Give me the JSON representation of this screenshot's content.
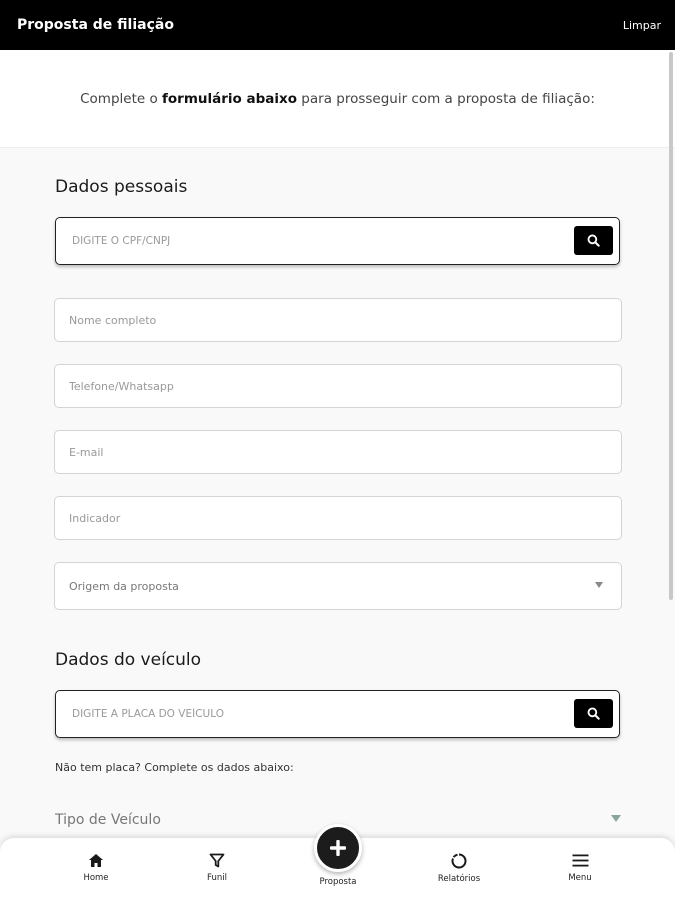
{
  "header": {
    "title": "Proposta de filiação",
    "clear_label": "Limpar"
  },
  "intro": {
    "before": "Complete o ",
    "bold": "formulário abaixo",
    "after": " para prosseguir com a proposta de filiação:"
  },
  "personal": {
    "title": "Dados pessoais",
    "cpf_placeholder": "DIGITE O CPF/CNPJ",
    "name_placeholder": "Nome completo",
    "phone_placeholder": "Telefone/Whatsapp",
    "email_placeholder": "E-mail",
    "referrer_placeholder": "Indicador",
    "origin_placeholder": "Origem da proposta"
  },
  "vehicle": {
    "title": "Dados do veículo",
    "plate_placeholder": "DIGITE A PLACA DO VEÍCULO",
    "no_plate_hint": "Não tem placa? Complete os dados abaixo:",
    "type_label": "Tipo de Veículo"
  },
  "nav": {
    "home": "Home",
    "funnel": "Funil",
    "proposal": "Proposta",
    "reports": "Relatórios",
    "menu": "Menu"
  },
  "colors": {
    "header_bg": "#000000",
    "accent": "#1c1c1c",
    "caret": "#8aa5a0"
  }
}
